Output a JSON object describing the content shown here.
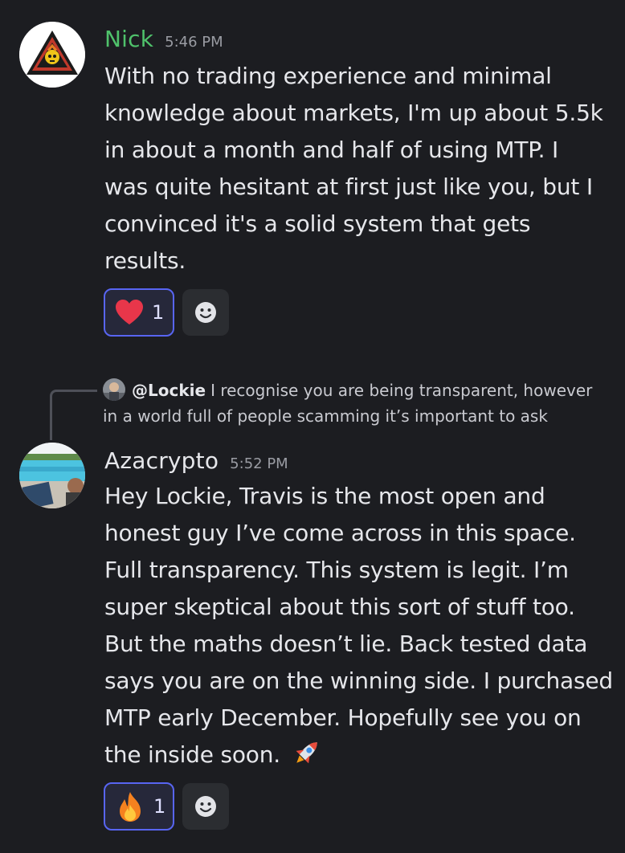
{
  "messages": [
    {
      "username": "Nick",
      "username_color": "#4fc26b",
      "timestamp": "5:46 PM",
      "avatar_icon": "hazard-triangle-skull-avatar",
      "lines": [
        "With no trading experience and minimal",
        "knowledge about markets, I'm up about 5.5k",
        "in about a month and half of using MTP.  I",
        "was quite hesitant at first just like you, but I",
        "convinced it's a solid system that gets",
        "results."
      ],
      "reaction": {
        "icon": "heart-icon",
        "count": "1"
      }
    },
    {
      "username": "Azacrypto",
      "username_color": "#e6e7eb",
      "timestamp": "5:52 PM",
      "avatar_icon": "poolside-photo-avatar",
      "reply": {
        "user": "@Lockie",
        "text_line1": "I recognise you are being transparent, however",
        "text_line2": "in a world full of people scamming it’s important to ask"
      },
      "lines": [
        "Hey Lockie, Travis is the most open and",
        "honest guy I’ve come across in this space.",
        "Full transparency. This system is legit. I’m",
        "super skeptical about this sort of stuff too.",
        "But the maths doesn’t lie. Back tested data",
        "says you are on the winning side. I purchased",
        "MTP early December. Hopefully see you on",
        "the inside soon."
      ],
      "trailing_emoji": "rocket-icon",
      "reaction": {
        "icon": "fire-icon",
        "count": "1"
      }
    }
  ],
  "accent_color": "#5865f2"
}
